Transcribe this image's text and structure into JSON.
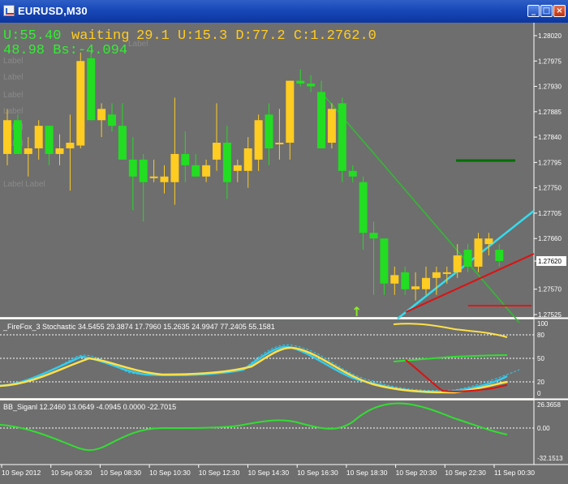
{
  "window": {
    "title": "EURUSD,M30"
  },
  "colors": {
    "background": "#6e6e6e",
    "bull": "#ffcc22",
    "bear": "#22dd22",
    "stoch_main": "#ffe14a",
    "stoch_signal": "#33ccee",
    "bb_line": "#33dd33",
    "trend_cyan": "#33ddee",
    "trend_red": "#dd1111",
    "dark_green": "#007700"
  },
  "overlay": {
    "line1_a": "U:55.40",
    "line1_b": "waiting",
    "line1_c": "29.1  U:15.3 D:77.2 C:1.2762.0",
    "line2": "48.98 Bs:-4.094",
    "faint_labels": [
      "Label",
      "Label",
      "Label",
      "Label",
      "Label",
      "Label",
      "Label",
      "Label  Label"
    ]
  },
  "main_chart": {
    "price_labels": [
      "1.28020",
      "1.27975",
      "1.27930",
      "1.27885",
      "1.27840",
      "1.27795",
      "1.27750",
      "1.27705",
      "1.27660",
      "1.27620",
      "1.27570",
      "1.27525"
    ],
    "current_price": "1.27620",
    "candles": [
      {
        "o": 1.2781,
        "h": 1.2789,
        "l": 1.2779,
        "c": 1.2787
      },
      {
        "o": 1.2787,
        "h": 1.2788,
        "l": 1.2781,
        "c": 1.2781
      },
      {
        "o": 1.2781,
        "h": 1.2784,
        "l": 1.2777,
        "c": 1.2782
      },
      {
        "o": 1.2782,
        "h": 1.2787,
        "l": 1.278,
        "c": 1.2786
      },
      {
        "o": 1.2786,
        "h": 1.2786,
        "l": 1.2779,
        "c": 1.2781
      },
      {
        "o": 1.2781,
        "h": 1.27845,
        "l": 1.2779,
        "c": 1.2782
      },
      {
        "o": 1.2782,
        "h": 1.2788,
        "l": 1.27745,
        "c": 1.2783
      },
      {
        "o": 1.27825,
        "h": 1.2799,
        "l": 1.2782,
        "c": 1.27975
      },
      {
        "o": 1.2798,
        "h": 1.2799,
        "l": 1.2787,
        "c": 1.2787
      },
      {
        "o": 1.2787,
        "h": 1.279,
        "l": 1.2784,
        "c": 1.2789
      },
      {
        "o": 1.2788,
        "h": 1.279,
        "l": 1.2785,
        "c": 1.2786
      },
      {
        "o": 1.2786,
        "h": 1.279,
        "l": 1.278,
        "c": 1.278
      },
      {
        "o": 1.278,
        "h": 1.2784,
        "l": 1.2771,
        "c": 1.2777
      },
      {
        "o": 1.278,
        "h": 1.2781,
        "l": 1.2769,
        "c": 1.2776
      },
      {
        "o": 1.2777,
        "h": 1.278,
        "l": 1.2776,
        "c": 1.2777
      },
      {
        "o": 1.2776,
        "h": 1.2779,
        "l": 1.2774,
        "c": 1.2777
      },
      {
        "o": 1.2776,
        "h": 1.2791,
        "l": 1.2772,
        "c": 1.2781
      },
      {
        "o": 1.2781,
        "h": 1.2785,
        "l": 1.2776,
        "c": 1.2779
      },
      {
        "o": 1.2779,
        "h": 1.2781,
        "l": 1.2777,
        "c": 1.2777
      },
      {
        "o": 1.2777,
        "h": 1.278,
        "l": 1.2776,
        "c": 1.2779
      },
      {
        "o": 1.278,
        "h": 1.279,
        "l": 1.2778,
        "c": 1.2783
      },
      {
        "o": 1.2783,
        "h": 1.2786,
        "l": 1.2773,
        "c": 1.2776
      },
      {
        "o": 1.2778,
        "h": 1.278,
        "l": 1.2776,
        "c": 1.2779
      },
      {
        "o": 1.2778,
        "h": 1.2784,
        "l": 1.2775,
        "c": 1.2782
      },
      {
        "o": 1.278,
        "h": 1.2788,
        "l": 1.2778,
        "c": 1.2787
      },
      {
        "o": 1.2788,
        "h": 1.279,
        "l": 1.2779,
        "c": 1.2782
      },
      {
        "o": 1.2783,
        "h": 1.2789,
        "l": 1.278,
        "c": 1.2783
      },
      {
        "o": 1.2783,
        "h": 1.2794,
        "l": 1.278,
        "c": 1.2794
      },
      {
        "o": 1.2794,
        "h": 1.2796,
        "l": 1.2793,
        "c": 1.27935
      },
      {
        "o": 1.27935,
        "h": 1.2795,
        "l": 1.2792,
        "c": 1.2793
      },
      {
        "o": 1.2792,
        "h": 1.2794,
        "l": 1.2782,
        "c": 1.2782
      },
      {
        "o": 1.2783,
        "h": 1.279,
        "l": 1.2782,
        "c": 1.2789
      },
      {
        "o": 1.279,
        "h": 1.2791,
        "l": 1.2776,
        "c": 1.2778
      },
      {
        "o": 1.2778,
        "h": 1.2779,
        "l": 1.2776,
        "c": 1.2777
      },
      {
        "o": 1.2776,
        "h": 1.2777,
        "l": 1.2764,
        "c": 1.2767
      },
      {
        "o": 1.2767,
        "h": 1.2769,
        "l": 1.2756,
        "c": 1.2766
      },
      {
        "o": 1.2766,
        "h": 1.2766,
        "l": 1.2756,
        "c": 1.2758
      },
      {
        "o": 1.2758,
        "h": 1.2761,
        "l": 1.2756,
        "c": 1.27595
      },
      {
        "o": 1.276,
        "h": 1.2761,
        "l": 1.2756,
        "c": 1.2757
      },
      {
        "o": 1.2757,
        "h": 1.276,
        "l": 1.2755,
        "c": 1.27575
      },
      {
        "o": 1.2757,
        "h": 1.2761,
        "l": 1.2756,
        "c": 1.2759
      },
      {
        "o": 1.2759,
        "h": 1.2761,
        "l": 1.2756,
        "c": 1.276
      },
      {
        "o": 1.276,
        "h": 1.2761,
        "l": 1.2758,
        "c": 1.276
      },
      {
        "o": 1.276,
        "h": 1.2765,
        "l": 1.2759,
        "c": 1.2763
      },
      {
        "o": 1.2764,
        "h": 1.2765,
        "l": 1.276,
        "c": 1.2761
      },
      {
        "o": 1.2761,
        "h": 1.2767,
        "l": 1.276,
        "c": 1.2766
      },
      {
        "o": 1.2765,
        "h": 1.2767,
        "l": 1.2763,
        "c": 1.2766
      },
      {
        "o": 1.2764,
        "h": 1.2765,
        "l": 1.2761,
        "c": 1.2762
      }
    ]
  },
  "stochastic": {
    "title": "_FireFox_3 Stochastic 34.5455 29.3874 17.7960 15.2635 24.9947 77.2405 55.1581",
    "levels": [
      "100",
      "80",
      "50",
      "20",
      "0"
    ]
  },
  "bb": {
    "title": "BB_Siganl 12.2460 13.0649 -4.0945 0.0000 -22.7015",
    "levels": [
      "26.3658",
      "0.00",
      "-32.1513"
    ]
  },
  "time_axis": [
    "10 Sep 2012",
    "10 Sep 06:30",
    "10 Sep 08:30",
    "10 Sep 10:30",
    "10 Sep 12:30",
    "10 Sep 14:30",
    "10 Sep 16:30",
    "10 Sep 18:30",
    "10 Sep 20:30",
    "10 Sep 22:30",
    "11 Sep 00:30"
  ]
}
